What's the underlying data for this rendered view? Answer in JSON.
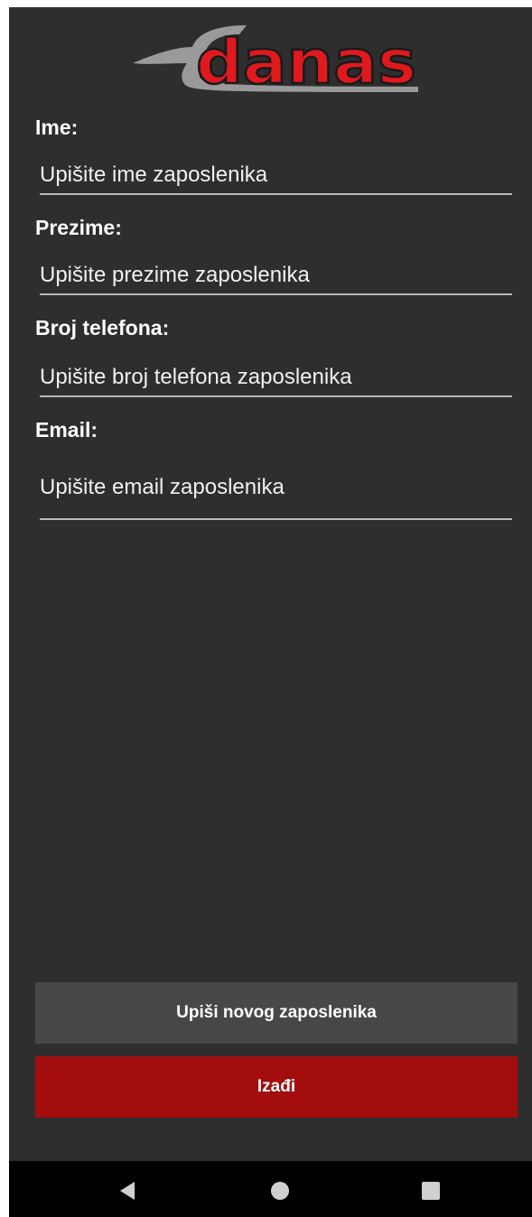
{
  "logo": {
    "text": "danas",
    "text_color": "#e0191f",
    "swoosh_color": "#9a9a9a"
  },
  "form": {
    "fields": [
      {
        "label": "Ime:",
        "value": "",
        "placeholder": "Upišite ime zaposlenika"
      },
      {
        "label": "Prezime:",
        "value": "",
        "placeholder": "Upišite prezime zaposlenika"
      },
      {
        "label": "Broj telefona:",
        "value": "",
        "placeholder": "Upišite broj telefona zaposlenika"
      },
      {
        "label": "Email:",
        "value": "",
        "placeholder": "Upišite email zaposlenika"
      }
    ]
  },
  "buttons": {
    "save_label": "Upiši novog zaposlenika",
    "exit_label": "Izađi"
  },
  "colors": {
    "background": "#2e2e2e",
    "save_button": "#474747",
    "exit_button": "#a30d0d"
  },
  "navigation": {
    "back_icon": "back-triangle-icon",
    "home_icon": "home-circle-icon",
    "recent_icon": "recent-apps-square-icon"
  }
}
